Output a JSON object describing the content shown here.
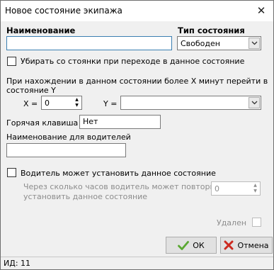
{
  "window": {
    "title": "Новое состояние экипажа",
    "close_glyph": "✕"
  },
  "name": {
    "label": "Наименование",
    "value": ""
  },
  "state_type": {
    "label": "Тип состояния",
    "value": "Свободен"
  },
  "remove_from_parking": {
    "label": "Убирать со стоянки при переходе в данное состояние",
    "checked": false
  },
  "timeout": {
    "description_line1": "При нахождении в данном состоянии более X минут перейти в",
    "description_line2": "состояние Y",
    "x_label": "X =",
    "x_value": "0",
    "y_label": "Y =",
    "y_value": ""
  },
  "hotkey": {
    "label": "Горячая клавиша",
    "value": "Нет"
  },
  "driver_name": {
    "label": "Наименование для водителей",
    "value": ""
  },
  "driver_can_set": {
    "label": "Водитель может установить данное состояние",
    "checked": false
  },
  "repeat_hours": {
    "label_line1": "Через сколько часов водитель может повторно",
    "label_line2": "установить данное состояние",
    "value": "0"
  },
  "deleted": {
    "label": "Удален",
    "checked": false
  },
  "buttons": {
    "ok": "ОК",
    "cancel": "Отмена"
  },
  "status": {
    "id_text": "ИД: 11"
  },
  "colors": {
    "ok_check": "#5aa832",
    "cancel_x": "#cc2a1f",
    "focus_border": "#3c7fb1"
  },
  "icons": {
    "ok": "check-icon",
    "cancel": "cross-icon",
    "combo": "chevron-down-icon",
    "spin": "spin-arrows-icon"
  }
}
